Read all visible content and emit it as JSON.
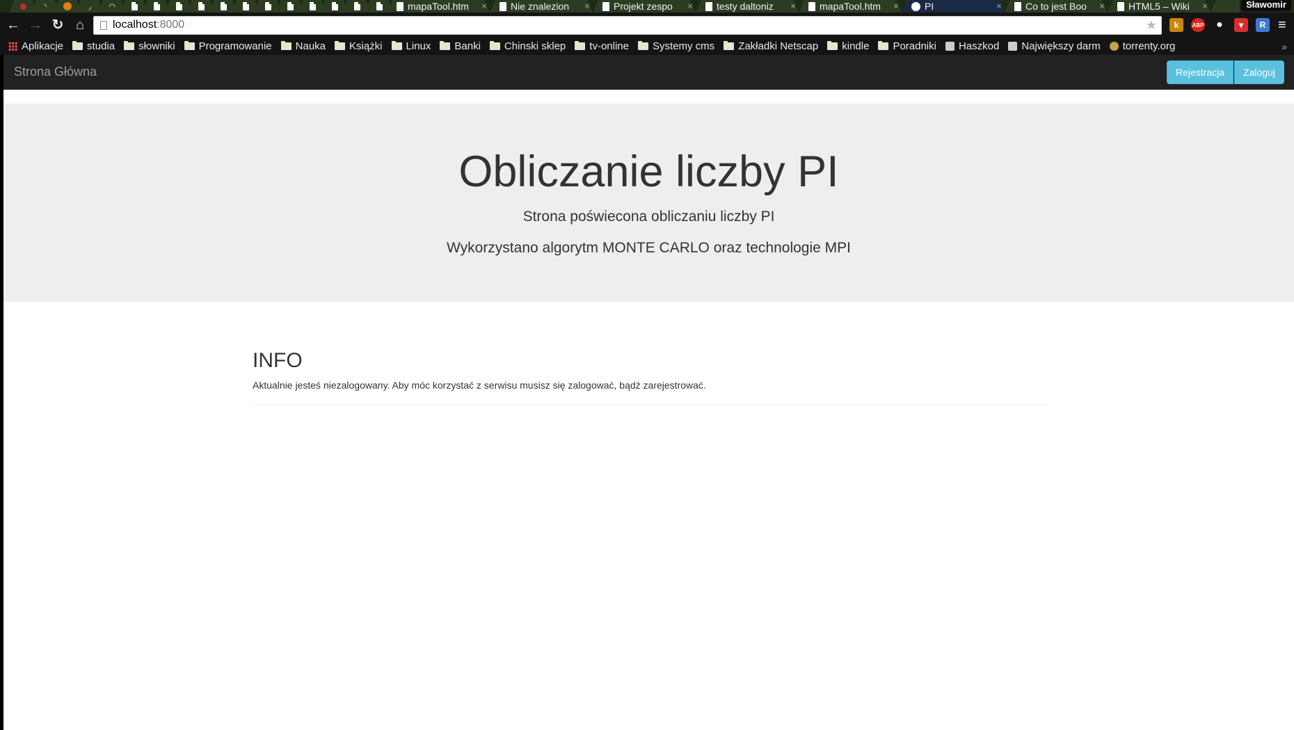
{
  "browser": {
    "tabs": [
      {
        "title": "mapaTool.htm",
        "active": false
      },
      {
        "title": "Nie znalezion",
        "active": false
      },
      {
        "title": "Projekt zespo",
        "active": false
      },
      {
        "title": "testy daltoniz",
        "active": false
      },
      {
        "title": "mapaTool.htm",
        "active": false
      },
      {
        "title": "PI",
        "active": true
      },
      {
        "title": "Co to jest Boo",
        "active": false
      },
      {
        "title": "HTML5 – Wiki",
        "active": false
      }
    ],
    "profile_name": "Sławomir",
    "close_glyph": "×",
    "url_host": "localhost",
    "url_port": ":8000",
    "bookmarks": [
      {
        "label": "Aplikacje",
        "icon": "apps-icon"
      },
      {
        "label": "studia",
        "icon": "folder-icon"
      },
      {
        "label": "słowniki",
        "icon": "folder-icon"
      },
      {
        "label": "Programowanie",
        "icon": "folder-icon"
      },
      {
        "label": "Nauka",
        "icon": "folder-icon"
      },
      {
        "label": "Książki",
        "icon": "folder-icon"
      },
      {
        "label": "Linux",
        "icon": "folder-icon"
      },
      {
        "label": "Banki",
        "icon": "folder-icon"
      },
      {
        "label": "Chinski sklep",
        "icon": "folder-icon"
      },
      {
        "label": "tv-online",
        "icon": "folder-icon"
      },
      {
        "label": "Systemy cms",
        "icon": "folder-icon"
      },
      {
        "label": "Zakładki Netscap",
        "icon": "folder-icon"
      },
      {
        "label": "kindle",
        "icon": "folder-icon"
      },
      {
        "label": "Poradniki",
        "icon": "folder-icon"
      },
      {
        "label": "Haszkod",
        "icon": "site-icon"
      },
      {
        "label": "Największy darm",
        "icon": "site-icon"
      },
      {
        "label": "torrenty.org",
        "icon": "site-icon"
      }
    ],
    "bookmarks_more": "»",
    "extensions": [
      {
        "name": "k-extension-icon",
        "glyph": "k",
        "color": "#c8860a"
      },
      {
        "name": "adblock-icon",
        "glyph": "ABP",
        "color": "#d9241c"
      },
      {
        "name": "chat-bubble-icon",
        "glyph": "💬",
        "color": "#141414"
      },
      {
        "name": "pdf-extension-icon",
        "glyph": "▾",
        "color": "#d32f2f"
      },
      {
        "name": "r-extension-icon",
        "glyph": "R",
        "color": "#3a7bd5"
      }
    ]
  },
  "site": {
    "brand": "Strona Główna",
    "register_label": "Rejestracja",
    "login_label": "Zaloguj",
    "hero": {
      "title": "Obliczanie liczby PI",
      "subtitle": "Strona poświecona obliczaniu liczby PI",
      "subtitle2": "Wykorzystano algorytm MONTE CARLO oraz technologie MPI"
    },
    "info": {
      "heading": "INFO",
      "text": "Aktualnie jesteś niezalogowany. Aby móc korzystać z serwisu musisz się zalogować, bądź zarejestrować."
    }
  },
  "colors": {
    "navbar_bg": "#222222",
    "jumbotron_bg": "#eeeeee",
    "button_info": "#5bc0de"
  }
}
